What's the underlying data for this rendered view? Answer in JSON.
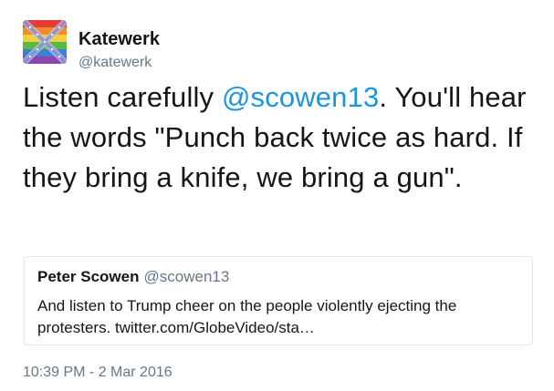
{
  "author": {
    "name": "Katewerk",
    "handle": "@katewerk",
    "avatar_icon": "rainbow-flag-avatar-icon"
  },
  "tweet": {
    "text_before": "Listen carefully ",
    "mention": "@scowen13",
    "text_after": ". You'll hear the words \"Punch back twice as hard. If they bring a knife, we bring a gun\"."
  },
  "quoted_tweet": {
    "name": "Peter Scowen",
    "handle": "@scowen13",
    "text": "And listen to Trump cheer on the people violently ejecting the protesters. twitter.com/GlobeVideo/sta…"
  },
  "timestamp": "10:39 PM - 2 Mar 2016",
  "colors": {
    "link": "#1b95e0",
    "secondary_text": "#657786",
    "border": "#e1e8ed"
  }
}
